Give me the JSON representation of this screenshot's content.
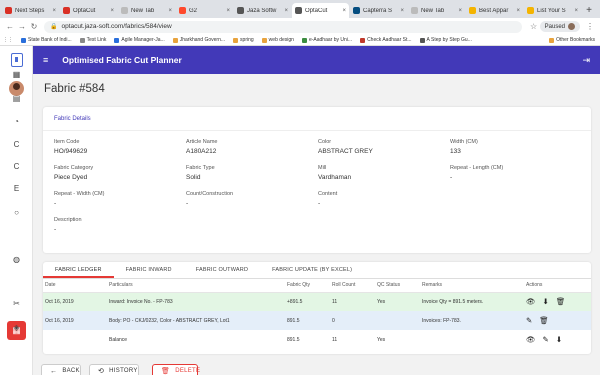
{
  "browser": {
    "tabs": [
      {
        "label": "Next Steps",
        "color": "#d93025",
        "active": false
      },
      {
        "label": "OptaCut",
        "color": "#d93025",
        "active": false
      },
      {
        "label": "New Tab",
        "color": "#bbbbbb",
        "active": false
      },
      {
        "label": "G2",
        "color": "#ff492c",
        "active": false
      },
      {
        "label": "Jaza Softw",
        "color": "#555555",
        "active": false
      },
      {
        "label": "OptaCut",
        "color": "#555555",
        "active": true
      },
      {
        "label": "Capterra S",
        "color": "#044d80",
        "active": false
      },
      {
        "label": "New Tab",
        "color": "#bbbbbb",
        "active": false
      },
      {
        "label": "Best Appar",
        "color": "#f4b400",
        "active": false
      },
      {
        "label": "List Your S",
        "color": "#f4b400",
        "active": false
      }
    ],
    "url": "optacut.jaza-soft.com/fabrics/584/view",
    "profile_status": "Paused",
    "bookmarks": [
      {
        "label": "State Bank of Indi...",
        "color": "#2a6fdb"
      },
      {
        "label": "Test Link",
        "color": "#888888"
      },
      {
        "label": "Agile Manager-Ja...",
        "color": "#2a6fdb"
      },
      {
        "label": "Jharkhand Govern...",
        "color": "#e8a33d"
      },
      {
        "label": "spring",
        "color": "#e8a33d"
      },
      {
        "label": "web design",
        "color": "#e8a33d"
      },
      {
        "label": "e-Aadhaar by Uni...",
        "color": "#3c8d40"
      },
      {
        "label": "Check Aadhaar St...",
        "color": "#c0392b"
      },
      {
        "label": "A Step by Step Gu...",
        "color": "#555555"
      }
    ],
    "other_bookmarks": "Other Bookmarks"
  },
  "rail": {
    "items": [
      {
        "icon": "dashboard-icon",
        "glyph": "▦"
      },
      {
        "icon": "clipboard-icon",
        "glyph": "▤"
      },
      {
        "icon": "gauge-icon",
        "glyph": "◔"
      },
      {
        "icon": "letter-c-icon",
        "glyph": "C"
      },
      {
        "icon": "letter-c-icon",
        "glyph": "C"
      },
      {
        "icon": "letter-e-icon",
        "glyph": "E"
      },
      {
        "icon": "circle-icon",
        "glyph": "○"
      },
      {
        "icon": "palette-icon",
        "glyph": "◍"
      },
      {
        "icon": "scissors-icon",
        "glyph": "✂"
      },
      {
        "icon": "layers-icon",
        "glyph": "◈"
      }
    ],
    "active_icon": "calculator-icon",
    "active_glyph": "▦"
  },
  "header": {
    "title": "Optimised Fabric Cut Planner",
    "accent_color": "#4239b8"
  },
  "page": {
    "title": "Fabric #584"
  },
  "details": {
    "heading": "Fabric Details",
    "fields": [
      {
        "label": "Item Code",
        "value": "HO/949629"
      },
      {
        "label": "Article Name",
        "value": "A180A212"
      },
      {
        "label": "Color",
        "value": "ABSTRACT GREY"
      },
      {
        "label": "Width (CM)",
        "value": "133"
      },
      {
        "label": "Fabric Category",
        "value": "Piece Dyed"
      },
      {
        "label": "Fabric Type",
        "value": "Solid"
      },
      {
        "label": "Mill",
        "value": "Vardhaman"
      },
      {
        "label": "Repeat - Length (CM)",
        "value": "-"
      },
      {
        "label": "Repeat - Width (CM)",
        "value": "-"
      },
      {
        "label": "Count/Construction",
        "value": "-"
      },
      {
        "label": "Content",
        "value": "-"
      },
      {
        "label": "",
        "value": ""
      },
      {
        "label": "Description",
        "value": "-"
      }
    ]
  },
  "ledger": {
    "tabs": [
      "FABRIC LEDGER",
      "FABRIC INWARD",
      "FABRIC OUTWARD",
      "FABRIC UPDATE (BY EXCEL)"
    ],
    "active_tab": 0,
    "columns": [
      "Date",
      "Particulars",
      "Fabric Qty",
      "Roll Count",
      "QC Status",
      "Remarks",
      "Actions"
    ],
    "rows": [
      {
        "date": "Oct 16, 2019",
        "particulars": "Inward: Invoice No. - FP-783",
        "qty": "+891.5",
        "rolls": "11",
        "qc": "Yes",
        "remarks": "Invoice Qty = 891.5 meters.",
        "actions": [
          "view-icon",
          "download-icon",
          "delete-icon"
        ],
        "tint": "green"
      },
      {
        "date": "Oct 16, 2019",
        "particulars": "Body: PO - CKJ/0232, Color - ABSTRACT GREY, Lot1",
        "qty": "891.5",
        "rolls": "0",
        "qc": "",
        "remarks": "Invoices: FP-783.",
        "actions": [
          "edit-icon",
          "delete-icon"
        ],
        "tint": "blue"
      },
      {
        "date": "",
        "particulars": "Balance",
        "qty": "891.5",
        "rolls": "11",
        "qc": "Yes",
        "remarks": "",
        "actions": [
          "view-icon",
          "edit-icon",
          "download-icon"
        ],
        "tint": "none"
      }
    ]
  },
  "buttons": {
    "back": "BACK",
    "history": "HISTORY",
    "delete": "DELETE"
  }
}
